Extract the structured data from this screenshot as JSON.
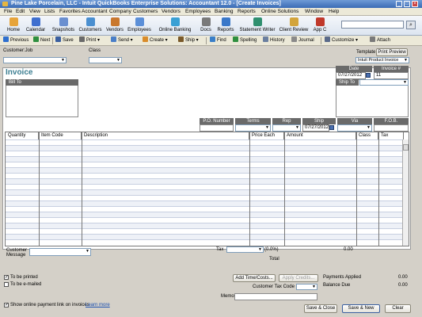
{
  "window": {
    "title": "Pine Lake Porcelain, LLC - Intuit QuickBooks Enterprise Solutions: Accountant 12.0 - [Create Invoices]"
  },
  "menu": [
    "File",
    "Edit",
    "View",
    "Lists",
    "Favorites",
    "Accountant",
    "Company",
    "Customers",
    "Vendors",
    "Employees",
    "Banking",
    "Reports",
    "Online Solutions",
    "Window",
    "Help"
  ],
  "iconbar": [
    "Home",
    "Calendar",
    "Snapshots",
    "Customers",
    "Vendors",
    "Employees",
    "Online Banking",
    "Docs",
    "Reports",
    "Statement Writer",
    "Client Review",
    "App C"
  ],
  "iconbar_colors": [
    "#e7a43a",
    "#3f6fcf",
    "#6a8fd0",
    "#4a8fd0",
    "#c9782e",
    "#5b8fd8",
    "#3aa0d4",
    "#7a7a7a",
    "#3a78c9",
    "#2f8f6f",
    "#d3a43a",
    "#c0392b"
  ],
  "formbar": {
    "previous": "Previous",
    "next": "Next",
    "save": "Save",
    "print": "Print",
    "send": "Send",
    "create": "Create",
    "ship": "Ship",
    "find": "Find",
    "spelling": "Spelling",
    "history": "History",
    "journal": "Journal",
    "customize": "Customize",
    "attach": "Attach"
  },
  "form": {
    "customer_job_label": "Customer:Job",
    "class_label": "Class",
    "template_label": "Template",
    "print_preview": "Print Preview",
    "template_value": "Intuit Product Invoice",
    "title": "Invoice",
    "date_label": "Date",
    "date_value": "07/27/2012",
    "invoice_no_label": "Invoice #",
    "invoice_no_value": "11",
    "bill_to": "Bill To",
    "ship_to": "Ship To",
    "po_number": "P.O. Number",
    "terms": "Terms",
    "rep": "Rep",
    "ship": "Ship",
    "ship_value": "07/27/2012",
    "via": "Via",
    "fob": "F.O.B."
  },
  "columns": [
    "Quantity",
    "Item Code",
    "Description",
    "Price Each",
    "Amount",
    "Class",
    "Tax"
  ],
  "totals": {
    "customer_message_label": "Customer Message",
    "tax_label": "Tax",
    "tax_pct": "(0.0%)",
    "tax_amount": "0.00",
    "total_label": "Total"
  },
  "footer": {
    "to_be_printed": "To be printed",
    "to_be_emailed": "To be e-mailed",
    "add_time_costs": "Add Time/Costs...",
    "apply_credits": "Apply Credits...",
    "payments_applied": "Payments Applied",
    "payments_value": "0.00",
    "customer_tax_code": "Customer Tax Code",
    "balance_due": "Balance Due",
    "balance_value": "0.00",
    "memo": "Memo",
    "show_online": "Show online payment link on invoices",
    "learn_more": "Learn more",
    "save_close": "Save & Close",
    "save_new": "Save & New",
    "clear": "Clear"
  }
}
